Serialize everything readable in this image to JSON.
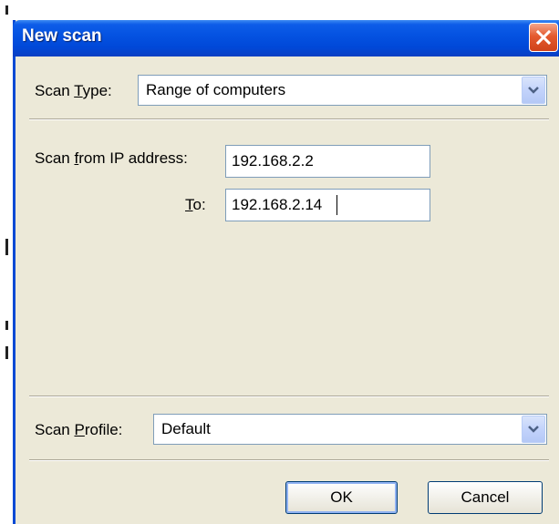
{
  "dialog": {
    "title": "New scan",
    "close_icon": "close-icon"
  },
  "scan_type": {
    "label_prefix": "Scan ",
    "label_accel": "T",
    "label_suffix": "ype:",
    "selected": "Range of computers"
  },
  "ip_range": {
    "from_label_prefix": "Scan ",
    "from_label_accel": "f",
    "from_label_suffix": "rom IP address:",
    "from_value": "192.168.2.2",
    "to_label_accel": "T",
    "to_label_suffix": "o:",
    "to_value": "192.168.2.14"
  },
  "scan_profile": {
    "label_prefix": "Scan ",
    "label_accel": "P",
    "label_suffix": "rofile:",
    "selected": "Default"
  },
  "buttons": {
    "ok": "OK",
    "cancel": "Cancel"
  },
  "colors": {
    "titlebar": "#0553e2",
    "dialog_bg": "#ece9d8",
    "close_button": "#e45a2e"
  }
}
